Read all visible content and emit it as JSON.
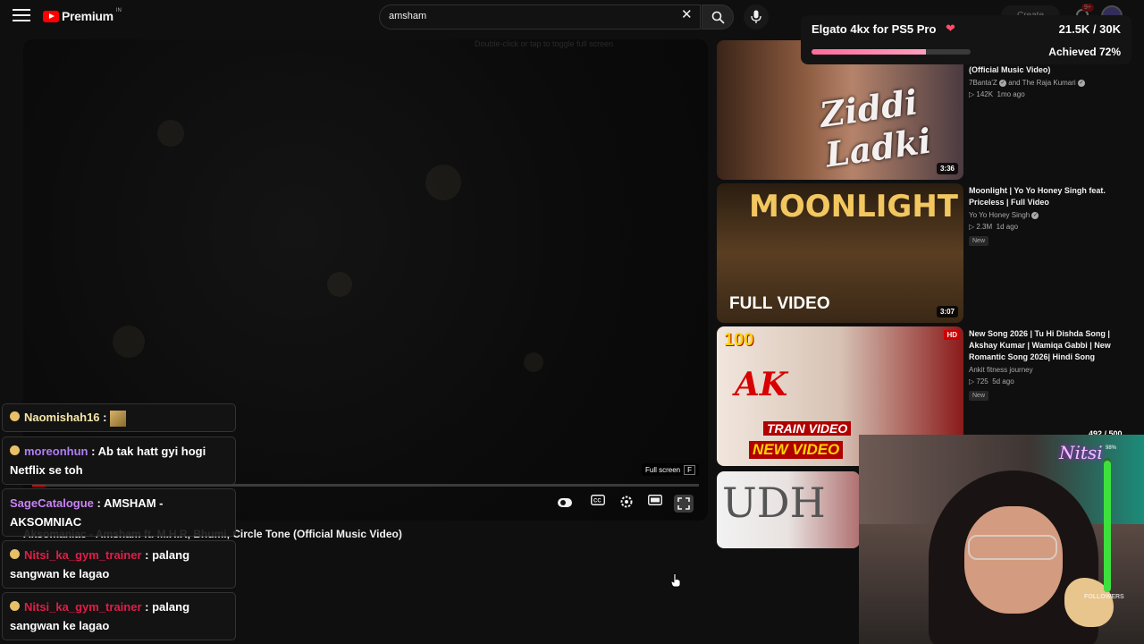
{
  "topbar": {
    "logo_text": "Premium",
    "logo_region": "IN",
    "search_value": "amsham",
    "create_label": "Create",
    "notification_count": "9+"
  },
  "goal": {
    "title": "Elgato 4kx for PS5 Pro",
    "count": "21.5K / 30K",
    "achieved": "Achieved 72%",
    "progress": 0.72
  },
  "player": {
    "hint": "Double-click or tap to toggle full screen",
    "fullscreen_tooltip": "Full screen",
    "fullscreen_key": "F",
    "progress": 0.02,
    "title": "Aksomaniac - Amsham ft. M.H.R, Bhumi, Circle Tone (Official Music Video)"
  },
  "recommendations": [
    {
      "title": "(Official Music Video)",
      "channel": "7Banta'Z",
      "channel2": "and The Raja Kumari",
      "views": "142K",
      "age": "1mo ago",
      "duration": "3:36",
      "thumb_text": "Ziddi Ladki",
      "badge": ""
    },
    {
      "title": "Moonlight | Yo Yo Honey Singh feat. Priceless | Full Video",
      "channel": "Yo Yo Honey Singh",
      "views": "2.3M",
      "age": "1d ago",
      "duration": "3:07",
      "thumb_text": "MOONLIGHT",
      "thumb_subtext": "FULL VIDEO",
      "badge": "New"
    },
    {
      "title": "New Song 2026 | Tu Hi Dishda Song | Akshay Kumar | Wamiqa Gabbi | New Romantic Song 2026| Hindi Song",
      "channel": "Ankit fitness journey",
      "views": "725",
      "age": "5d ago",
      "duration": "",
      "thumb_text": "AK",
      "thumb_subtext": "TRAIN VIDEO",
      "thumb_subtext2": "NEW VIDEO",
      "thumb_corner": "100",
      "badge": "New",
      "hd": "HD"
    },
    {
      "thumb_text": "UDH"
    }
  ],
  "chat": [
    {
      "user": "Naomishah16",
      "text": ""
    },
    {
      "user": "moreonhun",
      "text": "Ab tak hatt gyi hogi Netflix se toh"
    },
    {
      "user": "SageCatalogue",
      "text": "AMSHAM - AKSOMNIAC"
    },
    {
      "user": "Nitsi_ka_gym_trainer",
      "text": "palang sangwan ke lagao"
    },
    {
      "user": "Nitsi_ka_gym_trainer",
      "text": "palang sangwan ke lagao"
    }
  ],
  "webcam": {
    "counter": "492 / 500",
    "sign": "Nitsi",
    "followers_label": "FOLLOWERS",
    "followers_pct": "98%",
    "followers_progress": 0.98
  },
  "colors": {
    "accent": "#ff0000",
    "goal_fill": "#ff6b9d",
    "followers_fill": "#3ee03e"
  }
}
